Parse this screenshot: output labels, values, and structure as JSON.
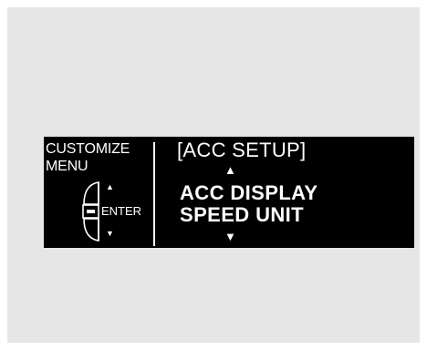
{
  "left_panel": {
    "title_line1": "CUSTOMIZE",
    "title_line2": "MENU",
    "enter_label": "ENTER",
    "up_glyph": "▲",
    "down_glyph": "▼",
    "control_icon": "selector-dial-icon"
  },
  "screen": {
    "title": "[ACC SETUP]",
    "arrow_up": "▲",
    "arrow_down": "▼",
    "options": [
      {
        "label": "ACC DISPLAY"
      },
      {
        "label": "SPEED UNIT"
      }
    ]
  },
  "colors": {
    "display_bg": "#000000",
    "display_fg": "#ffffff",
    "frame_bg": "#e6e6e6"
  }
}
